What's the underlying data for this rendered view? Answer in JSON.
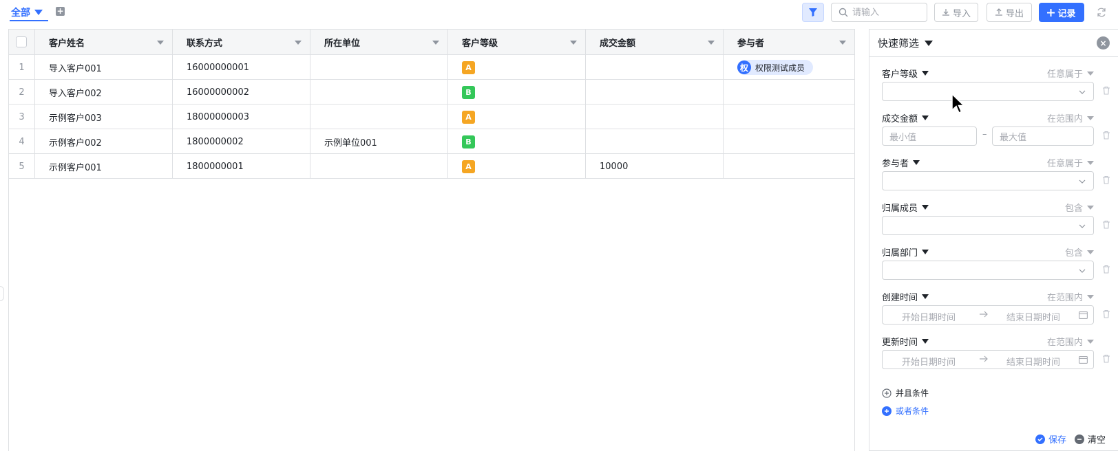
{
  "toolbar": {
    "view_tab": "全部",
    "search_placeholder": "请输入",
    "import_label": "导入",
    "export_label": "导出",
    "record_label": "记录"
  },
  "table": {
    "columns": [
      "客户姓名",
      "联系方式",
      "所在单位",
      "客户等级",
      "成交金额",
      "参与者"
    ],
    "rows": [
      {
        "index": "1",
        "name": "导入客户001",
        "phone": "16000000001",
        "company": "",
        "level": "A",
        "amount": "",
        "participant": "权限测试成员",
        "participant_avatar": "权"
      },
      {
        "index": "2",
        "name": "导入客户002",
        "phone": "16000000002",
        "company": "",
        "level": "B",
        "amount": "",
        "participant": ""
      },
      {
        "index": "3",
        "name": "示例客户003",
        "phone": "18000000003",
        "company": "",
        "level": "A",
        "amount": "",
        "participant": ""
      },
      {
        "index": "4",
        "name": "示例客户002",
        "phone": "1800000002",
        "company": "示例单位001",
        "level": "B",
        "amount": "",
        "participant": ""
      },
      {
        "index": "5",
        "name": "示例客户001",
        "phone": "1800000001",
        "company": "",
        "level": "A",
        "amount": "10000",
        "participant": ""
      }
    ],
    "level_colors": {
      "A": "#f5a623",
      "B": "#34c759"
    }
  },
  "filter_panel": {
    "title": "快速筛选",
    "fields": [
      {
        "label": "客户等级",
        "op": "任意属于",
        "kind": "select"
      },
      {
        "label": "成交金额",
        "op": "在范围内",
        "kind": "range",
        "min_placeholder": "最小值",
        "max_placeholder": "最大值",
        "sep": "–"
      },
      {
        "label": "参与者",
        "op": "任意属于",
        "kind": "select"
      },
      {
        "label": "归属成员",
        "op": "包含",
        "kind": "select"
      },
      {
        "label": "归属部门",
        "op": "包含",
        "kind": "select"
      },
      {
        "label": "创建时间",
        "op": "在范围内",
        "kind": "date",
        "start_placeholder": "开始日期时间",
        "end_placeholder": "结束日期时间"
      },
      {
        "label": "更新时间",
        "op": "在范围内",
        "kind": "date",
        "start_placeholder": "开始日期时间",
        "end_placeholder": "结束日期时间"
      }
    ],
    "and_label": "并且条件",
    "or_label": "或者条件",
    "save_label": "保存",
    "clear_label": "清空"
  },
  "colors": {
    "accent": "#3370ff",
    "border": "#dee0e3",
    "muted": "#8f959e"
  }
}
